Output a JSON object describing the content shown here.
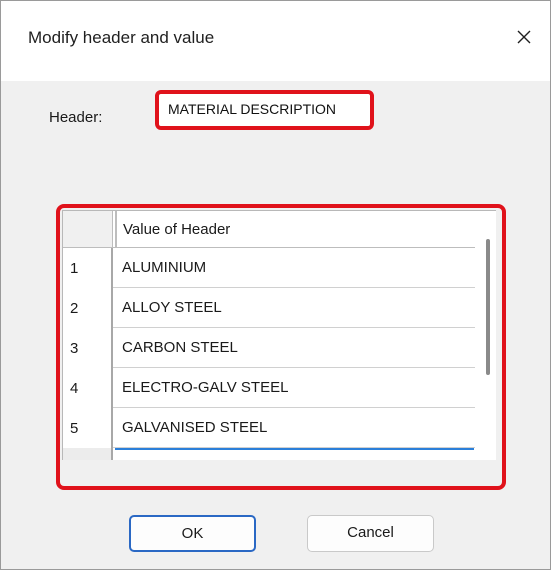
{
  "dialog": {
    "title": "Modify header and value",
    "close_icon": "close-icon"
  },
  "header_field": {
    "label": "Header:",
    "value": "MATERIAL DESCRIPTION"
  },
  "grid": {
    "column_header": "Value of Header",
    "rows": [
      {
        "num": "1",
        "value": "ALUMINIUM"
      },
      {
        "num": "2",
        "value": "ALLOY STEEL"
      },
      {
        "num": "3",
        "value": "CARBON STEEL"
      },
      {
        "num": "4",
        "value": "ELECTRO-GALV STEEL"
      },
      {
        "num": "5",
        "value": "GALVANISED STEEL"
      }
    ]
  },
  "buttons": {
    "ok": "OK",
    "cancel": "Cancel"
  },
  "colors": {
    "highlight": "#e0121b",
    "accent": "#2a68c4"
  }
}
